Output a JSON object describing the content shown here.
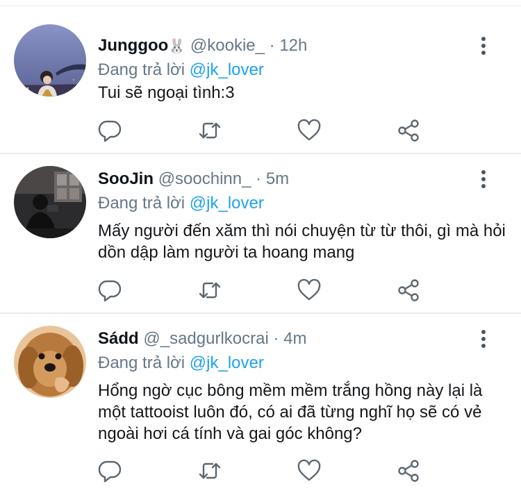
{
  "tweets": [
    {
      "name": "Junggoo",
      "name_emoji": "🐰",
      "handle": "@kookie_",
      "separator": "·",
      "time": "12h",
      "reply_prefix": "Đang trả lời",
      "reply_to": "@jk_lover",
      "text": "Tui sẽ ngoại tình:3"
    },
    {
      "name": "SooJin",
      "name_emoji": "",
      "handle": "@soochinn_",
      "separator": "·",
      "time": "5m",
      "reply_prefix": "Đang trả lời",
      "reply_to": "@jk_lover",
      "text": "Mấy người đến xăm thì nói chuyện từ từ thôi, gì mà hỏi dồn dập làm người ta hoang mang"
    },
    {
      "name": "Sádd",
      "name_emoji": "",
      "handle": "@_sadgurlkocrai",
      "separator": "·",
      "time": "4m",
      "reply_prefix": "Đang trả lời",
      "reply_to": "@jk_lover",
      "text": "Hổng ngờ cục bông mềm mềm trắng hồng này lại là một tattooist luôn đó, có ai đã từng nghĩ họ sẽ có vẻ ngoài hơi cá tính và gai góc không?"
    }
  ],
  "icons": {
    "reply": "reply-icon",
    "retweet": "retweet-icon",
    "like": "like-icon",
    "share": "share-icon",
    "more": "more-icon"
  },
  "colors": {
    "mention": "#1da1f2",
    "secondary_text": "#657786",
    "icon": "#5b6670",
    "divider": "#e6ecf0"
  }
}
